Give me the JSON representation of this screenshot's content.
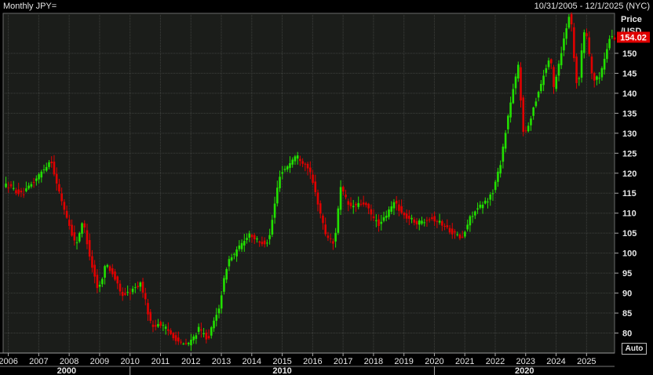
{
  "header": {
    "title": "Monthly JPY=",
    "date_range": "10/31/2005 - 12/1/2025 (NYC)"
  },
  "axis": {
    "unit_line1": "Price",
    "unit_line2": "/USD",
    "auto_label": "Auto"
  },
  "last_price": {
    "label": "154.02",
    "color": "#e00000"
  },
  "colors": {
    "background": "#000000",
    "plot_bg": "#1b1d1a",
    "grid": "#3e403d",
    "up": "#22e000",
    "down": "#e00000"
  },
  "chart_data": {
    "type": "candlestick",
    "title": "Monthly JPY=",
    "ylabel": "Price /USD",
    "ylim": [
      75,
      160
    ],
    "yticks": [
      80,
      85,
      90,
      95,
      100,
      105,
      110,
      115,
      120,
      125,
      130,
      135,
      140,
      145,
      150
    ],
    "x_start": 2005.83,
    "x_end": 2025.92,
    "xticks": [
      "2006",
      "2007",
      "2008",
      "2009",
      "2010",
      "2011",
      "2012",
      "2013",
      "2014",
      "2015",
      "2016",
      "2017",
      "2018",
      "2019",
      "2020",
      "2021",
      "2022",
      "2023",
      "2024",
      "2025"
    ],
    "decades": [
      "2000",
      "2010",
      "2020"
    ],
    "grid": true,
    "points": [
      [
        2006.0,
        117.0
      ],
      [
        2006.5,
        114.5
      ],
      [
        2007.0,
        119.0
      ],
      [
        2007.45,
        123.5
      ],
      [
        2007.6,
        118.0
      ],
      [
        2008.0,
        108.0
      ],
      [
        2008.25,
        102.0
      ],
      [
        2008.5,
        108.0
      ],
      [
        2008.75,
        98.0
      ],
      [
        2009.0,
        90.5
      ],
      [
        2009.25,
        97.5
      ],
      [
        2009.5,
        94.5
      ],
      [
        2009.75,
        89.5
      ],
      [
        2010.0,
        90.0
      ],
      [
        2010.4,
        92.5
      ],
      [
        2010.75,
        81.5
      ],
      [
        2011.0,
        82.5
      ],
      [
        2011.3,
        80.5
      ],
      [
        2011.75,
        77.0
      ],
      [
        2012.0,
        77.5
      ],
      [
        2012.3,
        81.0
      ],
      [
        2012.6,
        78.5
      ],
      [
        2012.95,
        86.0
      ],
      [
        2013.25,
        98.0
      ],
      [
        2013.5,
        100.0
      ],
      [
        2013.95,
        105.0
      ],
      [
        2014.3,
        102.5
      ],
      [
        2014.6,
        103.0
      ],
      [
        2014.95,
        119.5
      ],
      [
        2015.5,
        124.5
      ],
      [
        2015.9,
        121.5
      ],
      [
        2016.2,
        113.0
      ],
      [
        2016.45,
        105.0
      ],
      [
        2016.75,
        102.0
      ],
      [
        2016.95,
        116.5
      ],
      [
        2017.25,
        111.5
      ],
      [
        2017.75,
        112.5
      ],
      [
        2018.0,
        109.0
      ],
      [
        2018.25,
        107.0
      ],
      [
        2018.75,
        113.0
      ],
      [
        2019.0,
        109.5
      ],
      [
        2019.5,
        107.5
      ],
      [
        2019.9,
        109.0
      ],
      [
        2020.25,
        107.5
      ],
      [
        2020.5,
        106.0
      ],
      [
        2020.95,
        103.5
      ],
      [
        2021.25,
        109.5
      ],
      [
        2021.75,
        113.0
      ],
      [
        2021.95,
        115.0
      ],
      [
        2022.2,
        122.0
      ],
      [
        2022.5,
        136.0
      ],
      [
        2022.8,
        147.0
      ],
      [
        2022.95,
        131.0
      ],
      [
        2023.05,
        130.0
      ],
      [
        2023.4,
        139.0
      ],
      [
        2023.65,
        145.0
      ],
      [
        2023.85,
        149.5
      ],
      [
        2023.95,
        141.0
      ],
      [
        2024.2,
        150.0
      ],
      [
        2024.5,
        161.0
      ],
      [
        2024.7,
        143.0
      ],
      [
        2024.8,
        144.0
      ],
      [
        2024.9,
        152.0
      ],
      [
        2025.0,
        157.0
      ],
      [
        2025.25,
        143.0
      ],
      [
        2025.45,
        144.0
      ],
      [
        2025.6,
        147.5
      ],
      [
        2025.8,
        154.0
      ]
    ]
  }
}
